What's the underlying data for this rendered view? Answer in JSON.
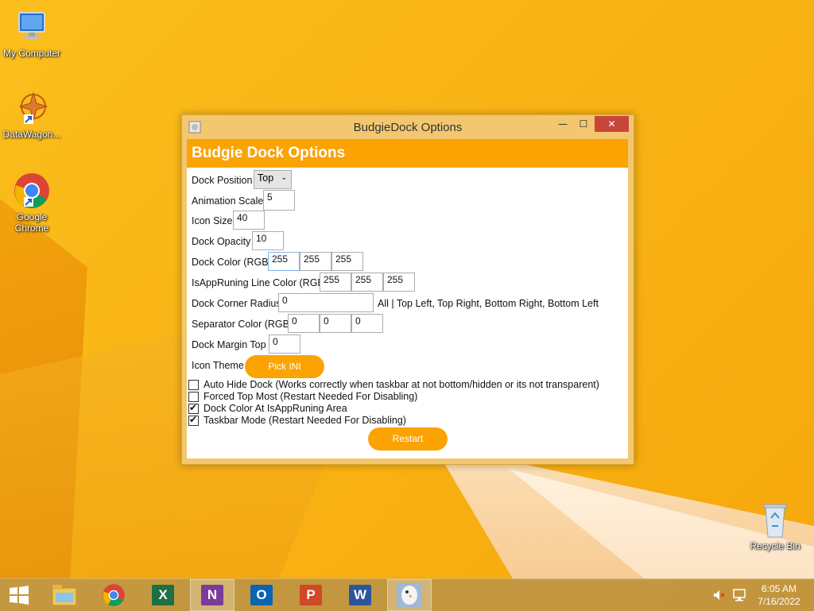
{
  "desktop": {
    "icons": [
      {
        "label": "My Computer"
      },
      {
        "label": "DataWagon..."
      },
      {
        "label": "Google Chrome"
      },
      {
        "label": "Recycle Bin"
      }
    ]
  },
  "window": {
    "title": "BudgieDock Options",
    "controls": {
      "minimize": "—",
      "maximize": "☐",
      "close": "✕"
    },
    "header": "Budgie Dock Options",
    "form": {
      "dock_position": {
        "label": "Dock Position",
        "value": "Top"
      },
      "animation_scale": {
        "label": "Animation Scale",
        "value": "5"
      },
      "icon_size": {
        "label": "Icon Size",
        "value": "40"
      },
      "dock_opacity": {
        "label": "Dock Opacity",
        "value": "10"
      },
      "dock_color": {
        "label": "Dock Color (RGB)",
        "r": "255",
        "g": "255",
        "b": "255"
      },
      "line_color": {
        "label": "IsAppRuning Line Color (RGB)",
        "r": "255",
        "g": "255",
        "b": "255"
      },
      "corner_radius": {
        "label": "Dock Corner Radius",
        "value": "0",
        "hint": "All | Top Left, Top Right, Bottom Right, Bottom Left"
      },
      "separator_color": {
        "label": "Separator Color (RGB)",
        "r": "0",
        "g": "0",
        "b": "0"
      },
      "margin_top": {
        "label": "Dock Margin Top",
        "value": "0"
      },
      "icon_theme": {
        "label": "Icon Theme",
        "button": "Pick INI"
      }
    },
    "options": [
      {
        "label": "Auto Hide Dock (Works correctly when taskbar at not bottom/hidden or its not transparent)",
        "checked": false
      },
      {
        "label": "Forced Top Most (Restart Needed For Disabling)",
        "checked": false
      },
      {
        "label": "Dock Color At IsAppRuning Area",
        "checked": true
      },
      {
        "label": "Taskbar Mode (Restart Needed For Disabling)",
        "checked": true
      }
    ],
    "restart_button": "Restart"
  },
  "taskbar": {
    "apps": [
      "start",
      "file-explorer",
      "chrome",
      "excel",
      "onenote",
      "outlook",
      "powerpoint",
      "word",
      "budgiedock"
    ],
    "clock": {
      "time": "6:05 AM",
      "date": "7/16/2022"
    }
  },
  "colors": {
    "accent": "#faa303",
    "close": "#c7463a"
  }
}
